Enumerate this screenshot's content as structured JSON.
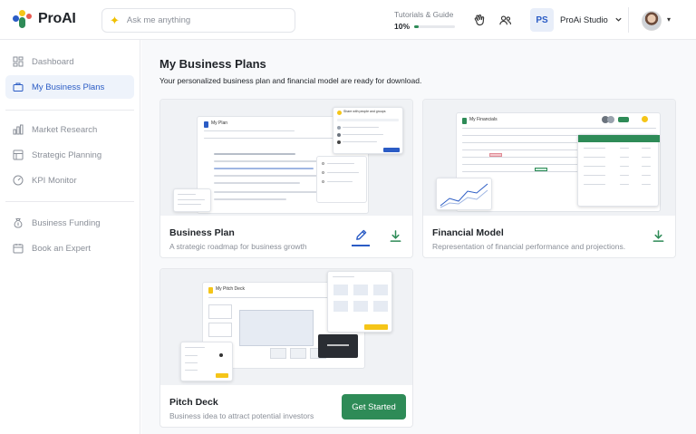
{
  "app": {
    "name": "ProAI",
    "search_placeholder": "Ask me anything"
  },
  "header": {
    "tutorial_label": "Tutorials & Guide",
    "tutorial_progress_text": "10%",
    "tutorial_progress_fraction": 0.1,
    "workspace_initials": "PS",
    "workspace_name": "ProAi Studio"
  },
  "sidebar": {
    "items": [
      {
        "label": "Dashboard",
        "icon": "dashboard-icon",
        "active": false
      },
      {
        "label": "My Business Plans",
        "icon": "briefcase-icon",
        "active": true
      },
      {
        "label": "Market Research",
        "icon": "bar-chart-icon",
        "active": false
      },
      {
        "label": "Strategic Planning",
        "icon": "strategy-icon",
        "active": false
      },
      {
        "label": "KPI Monitor",
        "icon": "gauge-icon",
        "active": false
      },
      {
        "label": "Business Funding",
        "icon": "money-bag-icon",
        "active": false
      },
      {
        "label": "Book an Expert",
        "icon": "calendar-icon",
        "active": false
      }
    ]
  },
  "main": {
    "title": "My Business Plans",
    "subtitle": "Your personalized business plan and financial model are ready for download.",
    "cards": [
      {
        "title": "Business Plan",
        "description": "A strategic roadmap for business growth",
        "preview_doc_title": "My Plan",
        "preview_share_title": "Share with people and groups"
      },
      {
        "title": "Financial Model",
        "description": "Representation of financial performance and projections.",
        "preview_doc_title": "My Financials"
      },
      {
        "title": "Pitch Deck",
        "description": "Business idea to attract potential investors",
        "button_label": "Get Started",
        "preview_doc_title": "My Pitch Deck"
      }
    ]
  },
  "colors": {
    "accent_blue": "#2b5cc5",
    "accent_green": "#2e8b57",
    "highlight_yellow": "#f5c518"
  }
}
